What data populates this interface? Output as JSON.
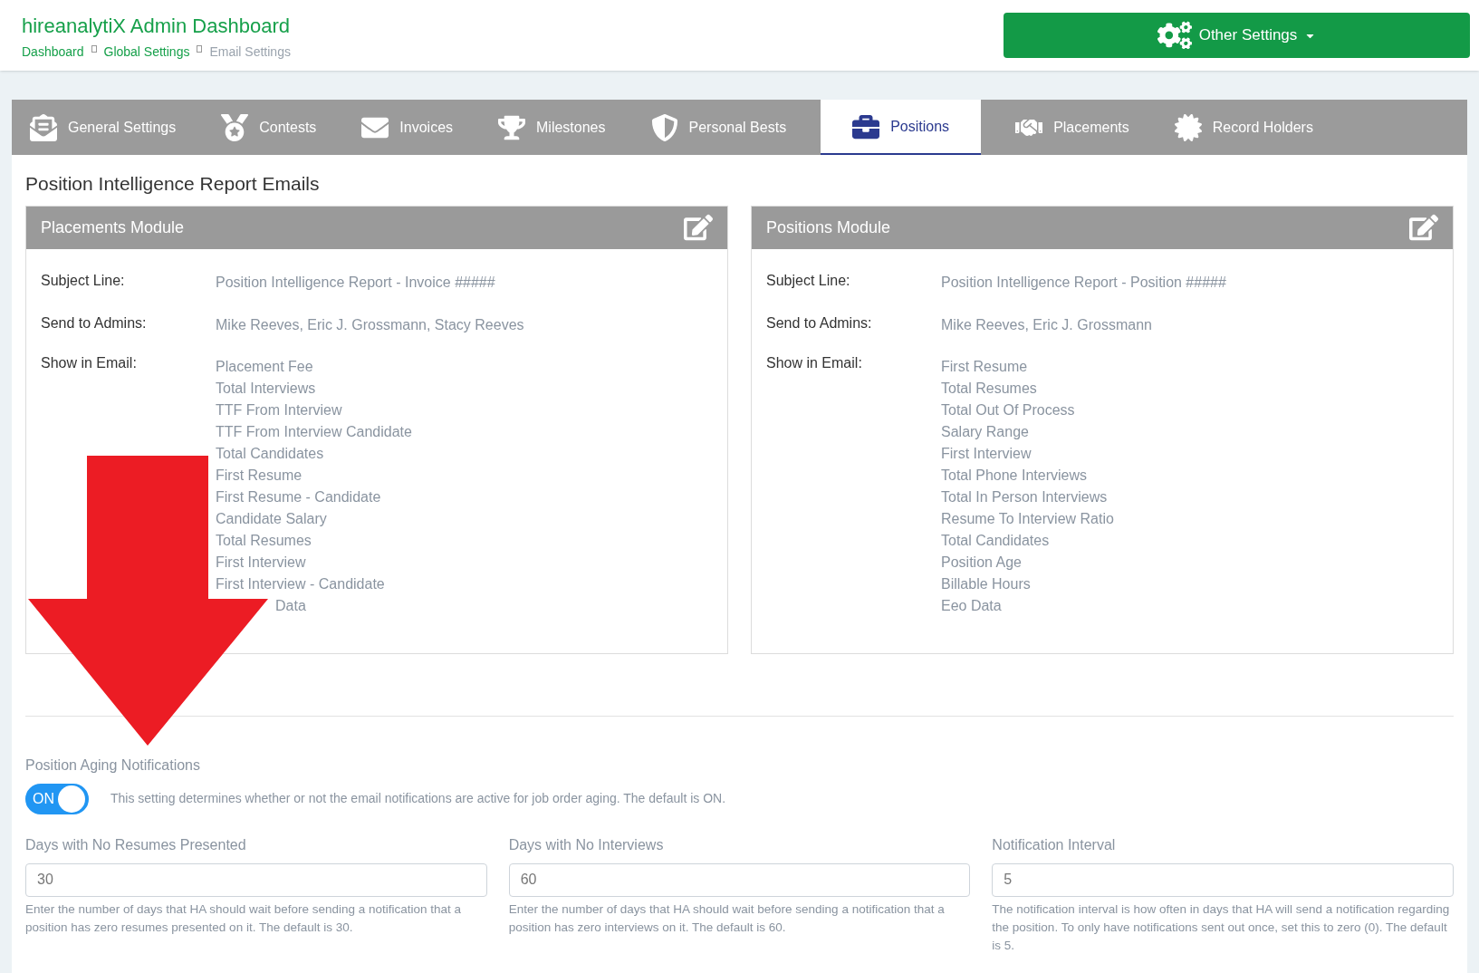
{
  "header": {
    "title": "hireanalytiX Admin Dashboard",
    "breadcrumbs": [
      {
        "label": "Dashboard",
        "current": false
      },
      {
        "label": "Global Settings",
        "current": false
      },
      {
        "label": "Email Settings",
        "current": true
      }
    ],
    "menu_button": "Other Settings"
  },
  "tabs": [
    {
      "label": "General Settings",
      "selected": false
    },
    {
      "label": "Contests",
      "selected": false
    },
    {
      "label": "Invoices",
      "selected": false
    },
    {
      "label": "Milestones",
      "selected": false
    },
    {
      "label": "Personal Bests",
      "selected": false
    },
    {
      "label": "Positions",
      "selected": true
    },
    {
      "label": "Placements",
      "selected": false
    },
    {
      "label": "Record Holders",
      "selected": false
    }
  ],
  "section_title": "Position Intelligence Report Emails",
  "modules": [
    {
      "title": "Placements Module",
      "subject_label": "Subject Line:",
      "subject": "Position Intelligence Report - Invoice #####",
      "admins_label": "Send to Admins:",
      "admins": "Mike Reeves, Eric J. Grossmann, Stacy Reeves",
      "show_label": "Show in Email:",
      "fields": [
        "Placement Fee",
        "Total Interviews",
        "TTF From Interview",
        "TTF From Interview Candidate",
        "Total Candidates",
        "First Resume",
        "First Resume - Candidate",
        "Candidate Salary",
        "Total Resumes",
        "First Interview",
        "First Interview - Candidate",
        {
          "kind": "covered",
          "label": "Data"
        }
      ]
    },
    {
      "title": "Positions Module",
      "subject_label": "Subject Line:",
      "subject": "Position Intelligence Report - Position #####",
      "admins_label": "Send to Admins:",
      "admins": "Mike Reeves, Eric J. Grossmann",
      "show_label": "Show in Email:",
      "fields": [
        "First Resume",
        "Total Resumes",
        "Total Out Of Process",
        "Salary Range",
        "First Interview",
        "Total Phone Interviews",
        "Total In Person Interviews",
        "Resume To Interview Ratio",
        "Total Candidates",
        "Position Age",
        "Billable Hours",
        "Eeo Data"
      ]
    }
  ],
  "aging": {
    "title": "Position Aging Notifications",
    "toggle": {
      "on": true,
      "label": "ON"
    },
    "description": "This setting determines whether or not the email notifications are active for job order aging. The default is ON."
  },
  "inputs": [
    {
      "label": "Days with No Resumes Presented",
      "value": "30",
      "help": "Enter the number of days that HA should wait before sending a notification that a position has zero resumes presented on it. The default is 30."
    },
    {
      "label": "Days with No Interviews",
      "value": "60",
      "help": "Enter the number of days that HA should wait before sending a notification that a position has zero interviews on it. The default is 60."
    },
    {
      "label": "Notification Interval",
      "value": "5",
      "help": "The notification interval is how often in days that HA will send a notification regarding the position. To only have notifications sent out once, set this to zero (0). The default is 5."
    }
  ]
}
